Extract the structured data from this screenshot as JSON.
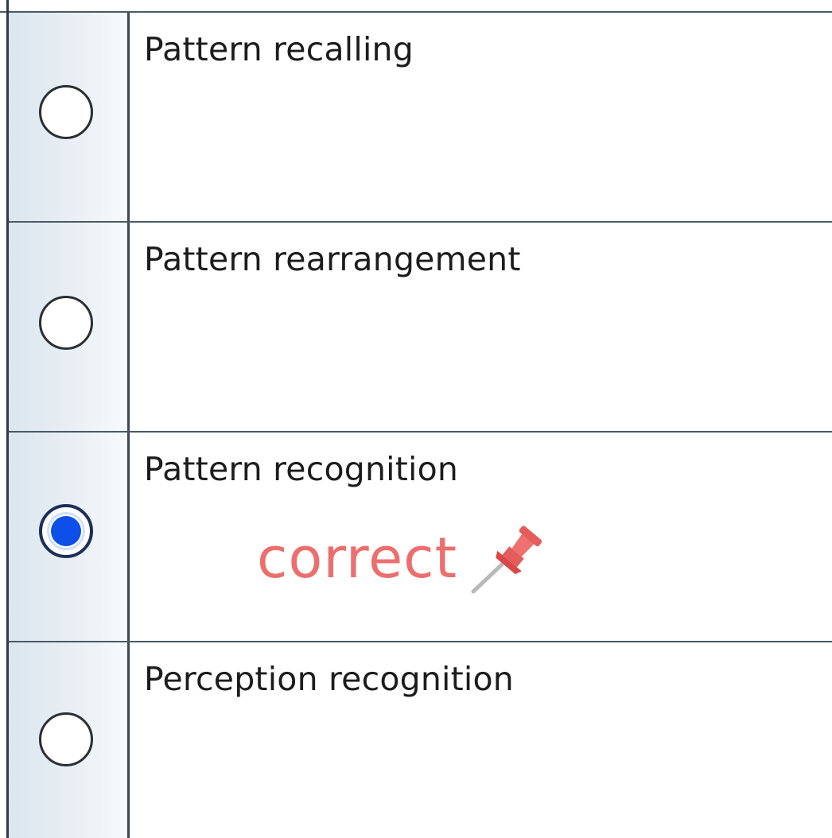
{
  "question": {
    "options": [
      {
        "label": "Pattern recalling",
        "selected": false
      },
      {
        "label": "Pattern rearrangement",
        "selected": false
      },
      {
        "label": "Pattern recognition",
        "selected": true
      },
      {
        "label": "Perception recognition",
        "selected": false
      }
    ],
    "feedback": {
      "text": "correct",
      "icon": "pushpin-icon",
      "color": "#ec6e6e"
    }
  },
  "colors": {
    "radio_selected": "#0d4fe8",
    "radio_column_bg": "#e3ebf1",
    "rule": "#4a5a66"
  }
}
